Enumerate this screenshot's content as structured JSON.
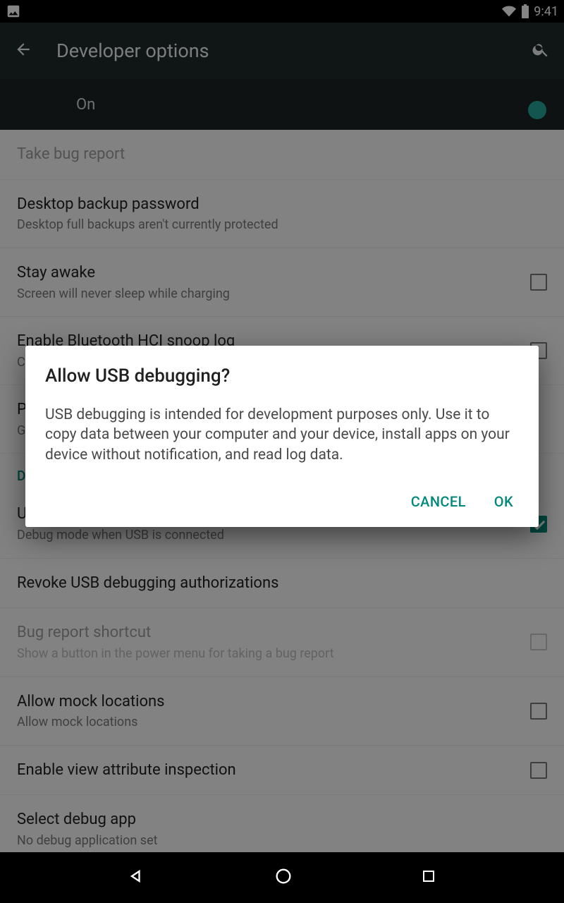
{
  "status": {
    "time": "9:41"
  },
  "appbar": {
    "title": "Developer options"
  },
  "master": {
    "label": "On"
  },
  "rows": {
    "bug_report": {
      "primary": "Take bug report"
    },
    "backup_pw": {
      "primary": "Desktop backup password",
      "secondary": "Desktop full backups aren't currently protected"
    },
    "stay_awake": {
      "primary": "Stay awake",
      "secondary": "Screen will never sleep while charging"
    },
    "bt_hci": {
      "primary": "Enable Bluetooth HCI snoop log",
      "secondary": "C"
    },
    "process_stats": {
      "primary": "P",
      "secondary": "G"
    },
    "section_debugging": "D",
    "usb_dbg": {
      "primary": "U",
      "secondary": "Debug mode when USB is connected"
    },
    "revoke": {
      "primary": "Revoke USB debugging authorizations"
    },
    "bug_shortcut": {
      "primary": "Bug report shortcut",
      "secondary": "Show a button in the power menu for taking a bug report"
    },
    "mock_loc": {
      "primary": "Allow mock locations",
      "secondary": "Allow mock locations"
    },
    "view_attr": {
      "primary": "Enable view attribute inspection"
    },
    "debug_app": {
      "primary": "Select debug app",
      "secondary": "No debug application set"
    }
  },
  "dialog": {
    "title": "Allow USB debugging?",
    "body": "USB debugging is intended for development purposes only. Use it to copy data between your computer and your device, install apps on your device without notification, and read log data.",
    "cancel": "Cancel",
    "ok": "OK"
  }
}
